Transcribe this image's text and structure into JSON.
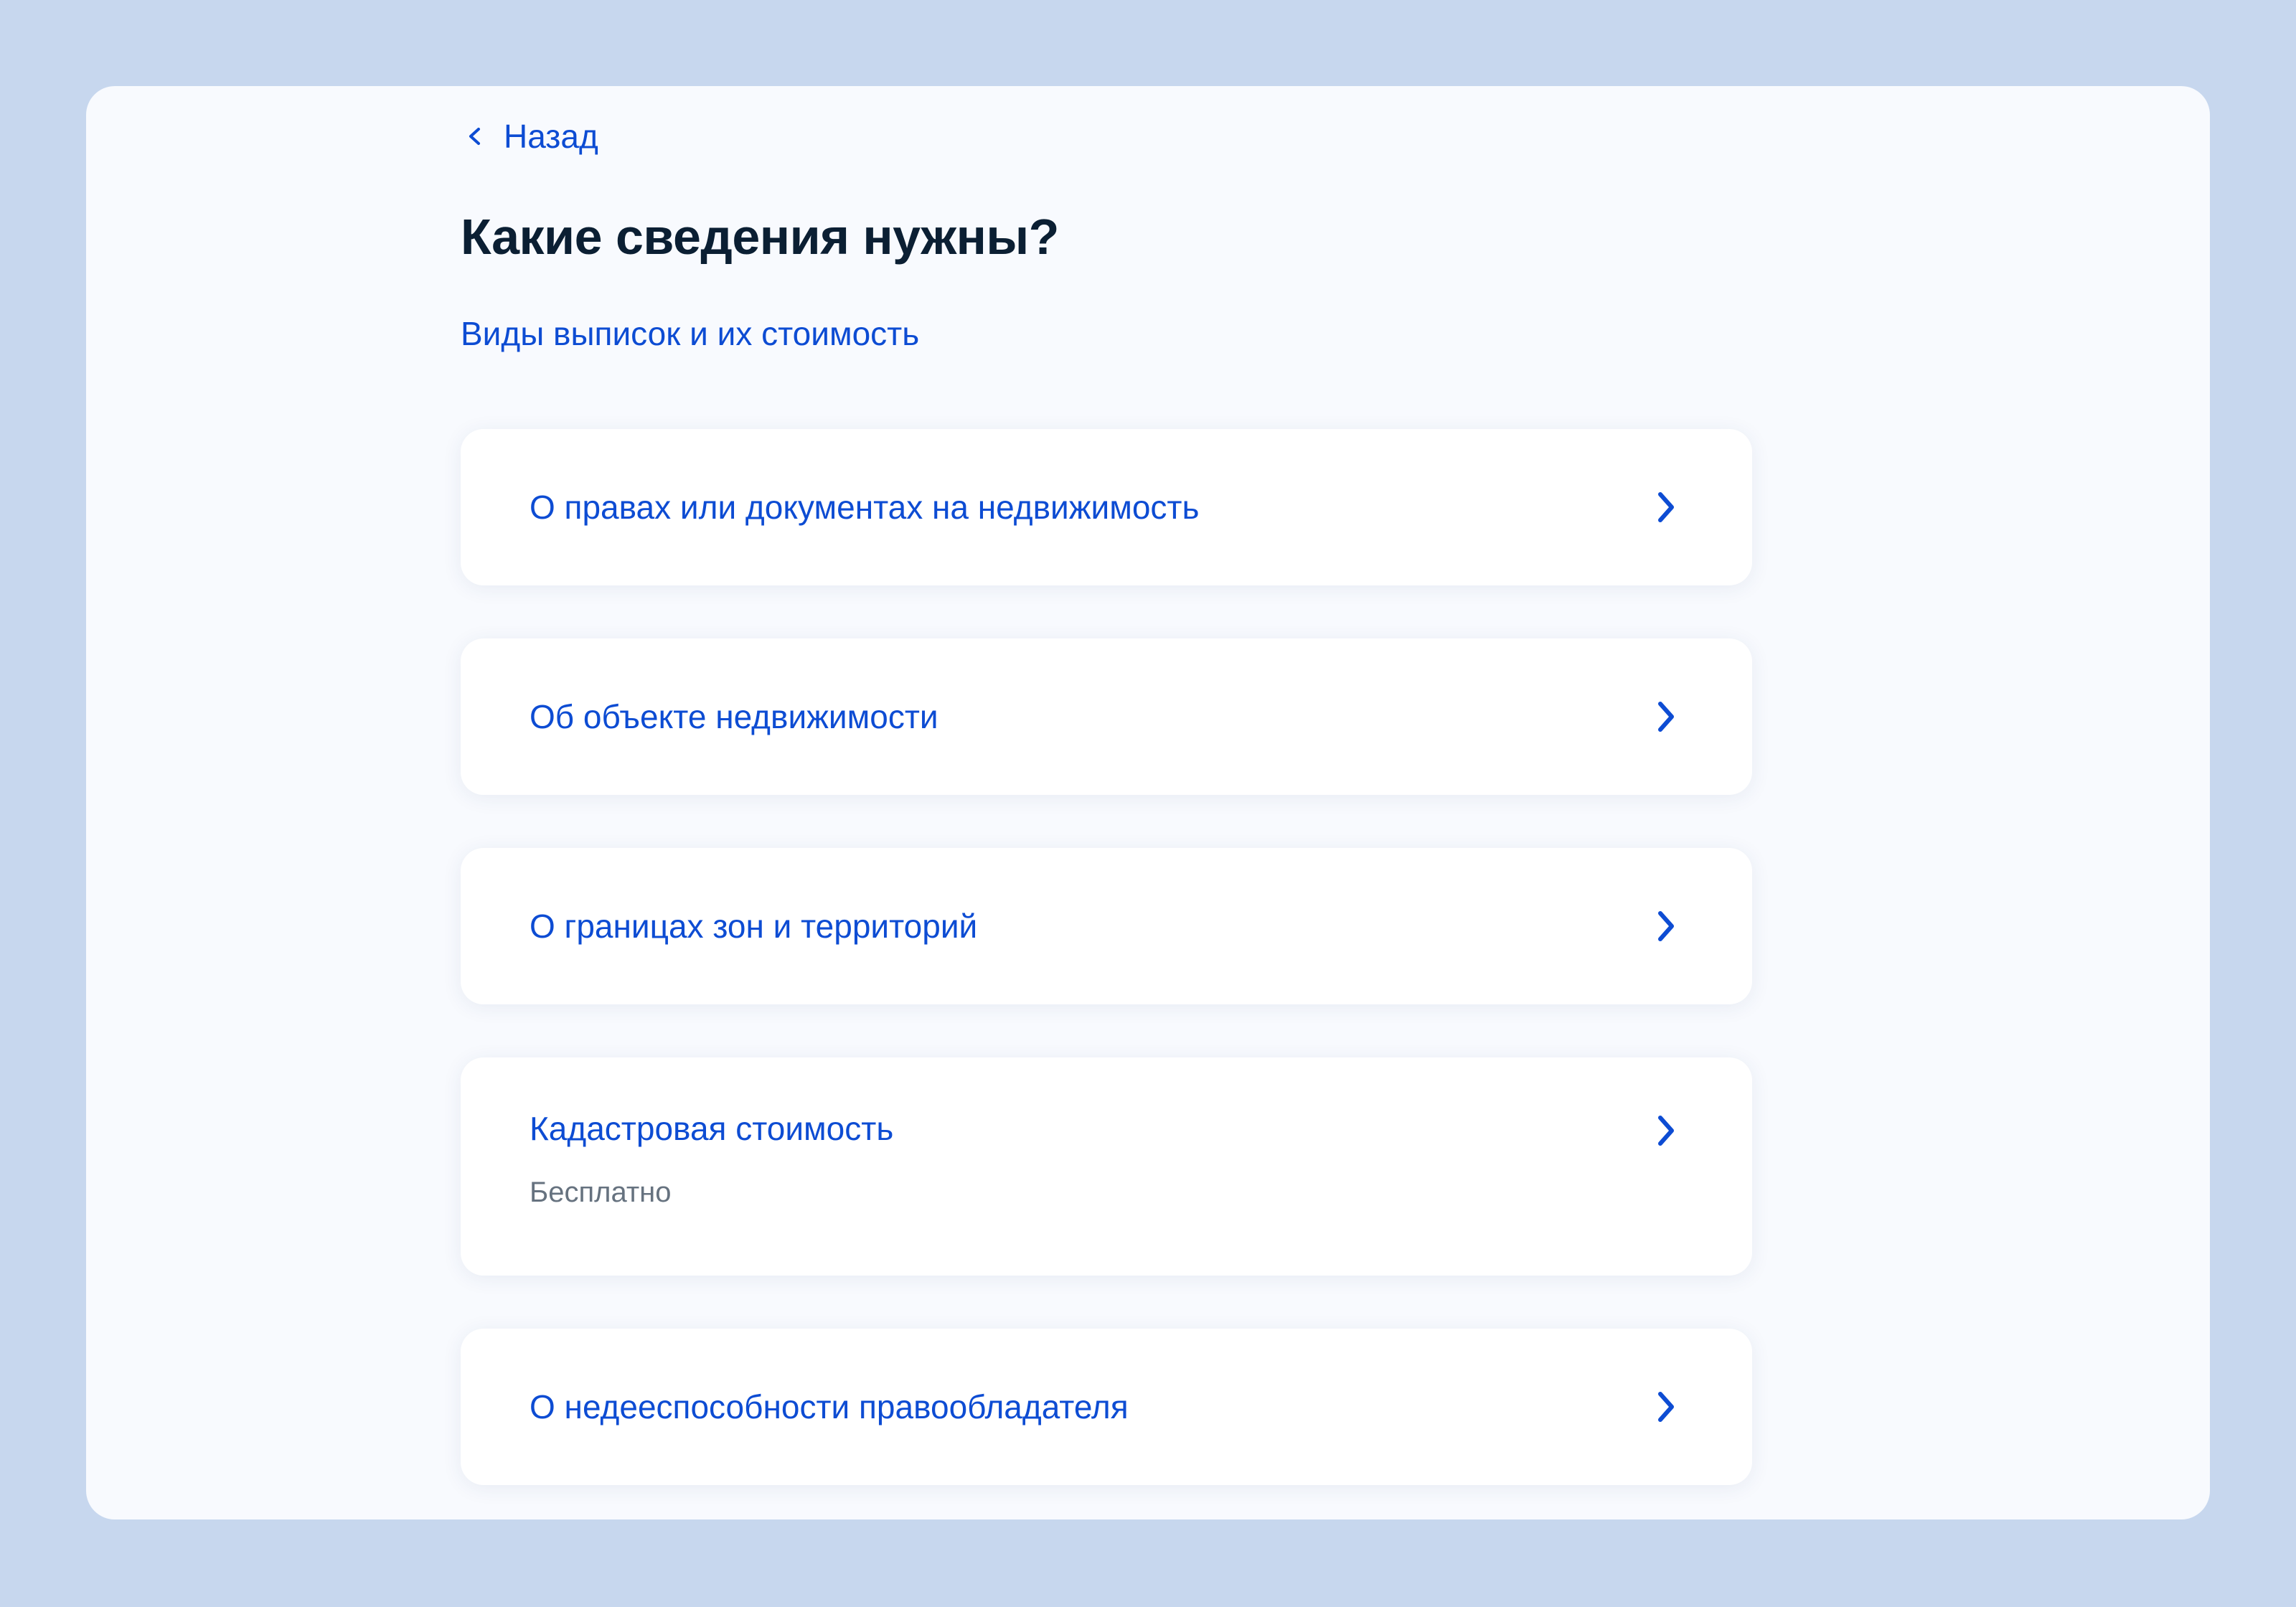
{
  "nav": {
    "back_label": "Назад"
  },
  "page": {
    "title": "Какие сведения нужны?",
    "sub_link": "Виды выписок и их стоимость"
  },
  "options": [
    {
      "label": "О правах или документах на недвижимость",
      "note": ""
    },
    {
      "label": "Об объекте недвижимости",
      "note": ""
    },
    {
      "label": "О границах зон и территорий",
      "note": ""
    },
    {
      "label": "Кадастровая стоимость",
      "note": "Бесплатно"
    },
    {
      "label": "О недееспособности правообладателя",
      "note": ""
    }
  ],
  "icons": {
    "back": "chevron-left-icon",
    "option_arrow": "chevron-right-icon"
  },
  "colors": {
    "page_background": "#c7d7ee",
    "window_background": "#f8fafe",
    "link_blue": "#0d4cd3",
    "title_dark": "#0b1f33",
    "note_gray": "#66727f"
  }
}
